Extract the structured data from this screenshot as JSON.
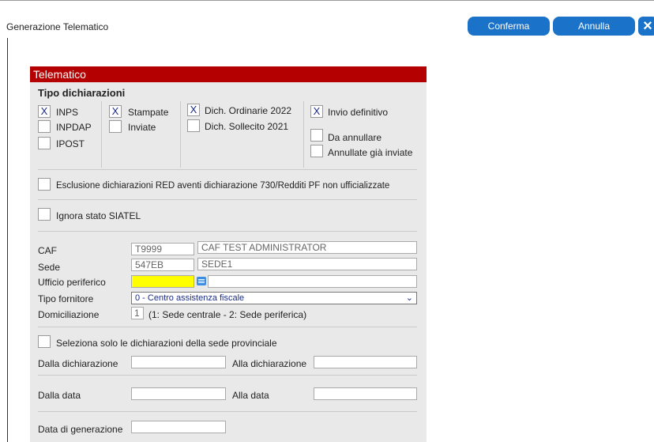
{
  "window": {
    "title": "Generazione Telematico",
    "confirm_label": "Conferma",
    "cancel_label": "Annulla",
    "close_glyph": "×"
  },
  "panel": {
    "title": "Telematico",
    "section_title": "Tipo dichiarazioni",
    "checkboxes": {
      "inps": {
        "label": "INPS",
        "checked": "X"
      },
      "inpdap": {
        "label": "INPDAP",
        "checked": ""
      },
      "ipost": {
        "label": "IPOST",
        "checked": ""
      },
      "stampate": {
        "label": "Stampate",
        "checked": "X"
      },
      "inviate": {
        "label": "Inviate",
        "checked": ""
      },
      "ordinarie": {
        "label": "Dich. Ordinarie 2022",
        "checked": "X"
      },
      "sollecito": {
        "label": "Dich. Sollecito 2021",
        "checked": ""
      },
      "definitivo": {
        "label": "Invio definitivo",
        "checked": "X"
      },
      "annullare": {
        "label": "Da annullare",
        "checked": ""
      },
      "annullate": {
        "label": "Annullate già inviate",
        "checked": ""
      },
      "esclusione": {
        "label": "Esclusione dichiarazioni RED aventi dichiarazione 730/Redditi PF non ufficializzate",
        "checked": ""
      },
      "siatel": {
        "label": "Ignora stato SIATEL",
        "checked": ""
      },
      "sede_prov": {
        "label": "Seleziona solo le dichiarazioni della sede provinciale",
        "checked": ""
      }
    },
    "fields": {
      "caf_label": "CAF",
      "caf_code": "T9999",
      "caf_name": "CAF TEST ADMINISTRATOR",
      "sede_label": "Sede",
      "sede_code": "547EB",
      "sede_name": "SEDE1",
      "ufficio_label": "Ufficio periferico",
      "ufficio_value": "",
      "fornitore_label": "Tipo fornitore",
      "fornitore_value": "0 - Centro assistenza fiscale",
      "domic_label": "Domiciliazione",
      "domic_value": "1",
      "domic_hint": "(1: Sede centrale - 2: Sede periferica)",
      "dalla_dich_label": "Dalla dichiarazione",
      "dalla_dich_value": "",
      "alla_dich_label": "Alla dichiarazione",
      "alla_dich_value": "",
      "dalla_data_label": "Dalla data",
      "dalla_data_value": "",
      "alla_data_label": "Alla data",
      "alla_data_value": "",
      "data_gen_label": "Data di generazione",
      "data_gen_value": ""
    }
  },
  "colors": {
    "accent": "#1a73c9",
    "header": "#b40000",
    "highlight": "#ffff00"
  },
  "icons": {
    "close": "close-icon",
    "lookup": "list-lookup-icon",
    "dropdown": "chevron-down-icon"
  }
}
